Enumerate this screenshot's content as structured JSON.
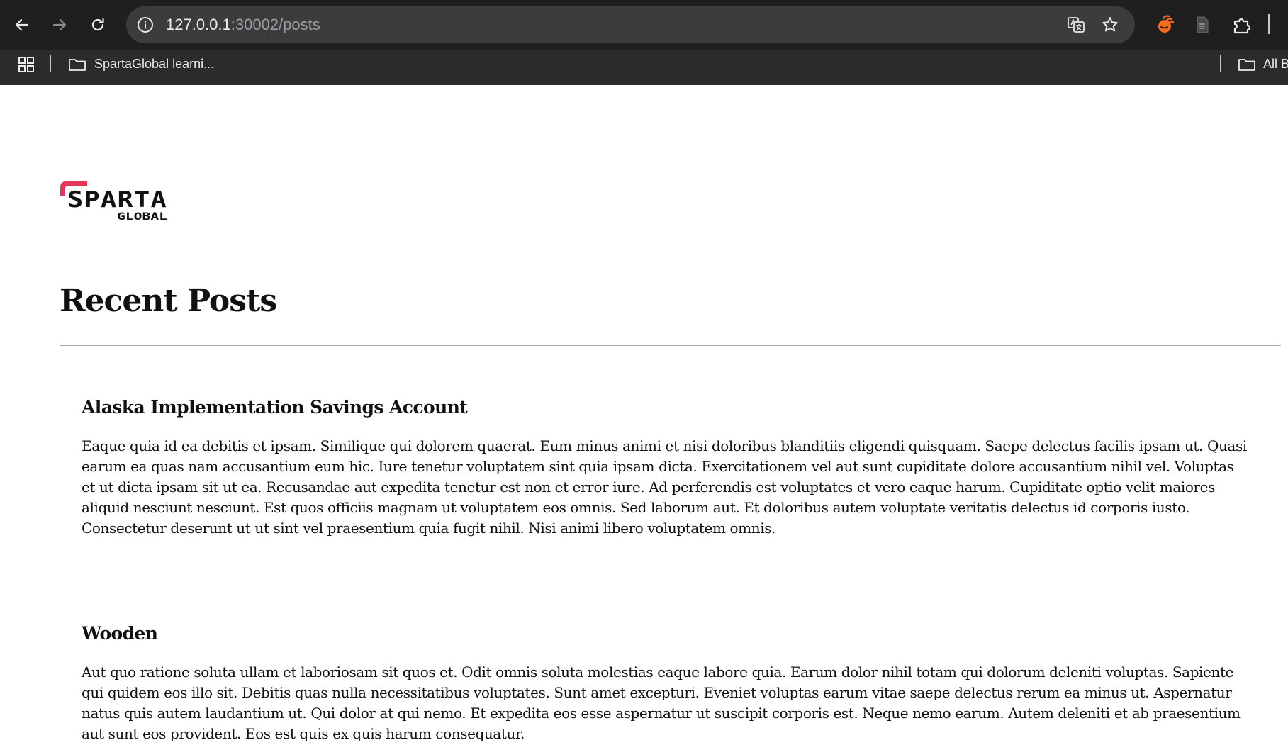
{
  "browser": {
    "url_host": "127.0.0.1",
    "url_rest": ":30002/posts",
    "bookmarks": [
      {
        "label": "SpartaGlobal learni..."
      },
      {
        "label": "All B"
      }
    ],
    "icons": {
      "back": "arrow-left",
      "forward": "arrow-right",
      "reload": "refresh",
      "info": "info-circle",
      "translate": "translate",
      "bookmark_star": "star-outline",
      "extension_orange": "orange-swirl",
      "extension_doc": "document",
      "extensions": "puzzle-piece",
      "apps": "grid",
      "folder": "folder-outline"
    },
    "colors": {
      "toolbar_bg": "#1f1f1f",
      "bookmarks_bg": "#2b2b2b",
      "omnibox_bg": "#3c3c3c",
      "text": "#e8eaed",
      "text_dim": "#9aa0a6",
      "extension_orange": "#f46a1e"
    }
  },
  "page": {
    "logo": {
      "word": "SPARTA",
      "subword": "GLOBAL",
      "accent_color": "#e8345b"
    },
    "title": "Recent Posts",
    "posts": [
      {
        "title": "Alaska Implementation Savings Account",
        "body": "Eaque quia id ea debitis et ipsam. Similique qui dolorem quaerat. Eum minus animi et nisi doloribus blanditiis eligendi quisquam. Saepe delectus facilis ipsam ut. Quasi earum ea quas nam accusantium eum hic. Iure tenetur voluptatem sint quia ipsam dicta. Exercitationem vel aut sunt cupiditate dolore accusantium nihil vel. Voluptas et ut dicta ipsam sit ut ea. Recusandae aut expedita tenetur est non et error iure. Ad perferendis est voluptates et vero eaque harum. Cupiditate optio velit maiores aliquid nesciunt nesciunt. Est quos officiis magnam ut voluptatem eos omnis. Sed laborum aut. Et doloribus autem voluptate veritatis delectus id corporis iusto. Consectetur deserunt ut ut sint vel praesentium quia fugit nihil. Nisi animi libero voluptatem omnis."
      },
      {
        "title": "Wooden",
        "body": "Aut quo ratione soluta ullam et laboriosam sit quos et. Odit omnis soluta molestias eaque labore quia. Earum dolor nihil totam qui dolorum deleniti voluptas. Sapiente qui quidem eos illo sit. Debitis quas nulla necessitatibus voluptates. Sunt amet excepturi. Eveniet voluptas earum vitae saepe delectus rerum ea minus ut. Aspernatur natus quis autem laudantium ut. Qui dolor at qui nemo. Et expedita eos esse aspernatur ut suscipit corporis est. Neque nemo earum. Autem deleniti et ab praesentium aut sunt eos provident. Eos est quis ex quis harum consequatur."
      }
    ]
  }
}
